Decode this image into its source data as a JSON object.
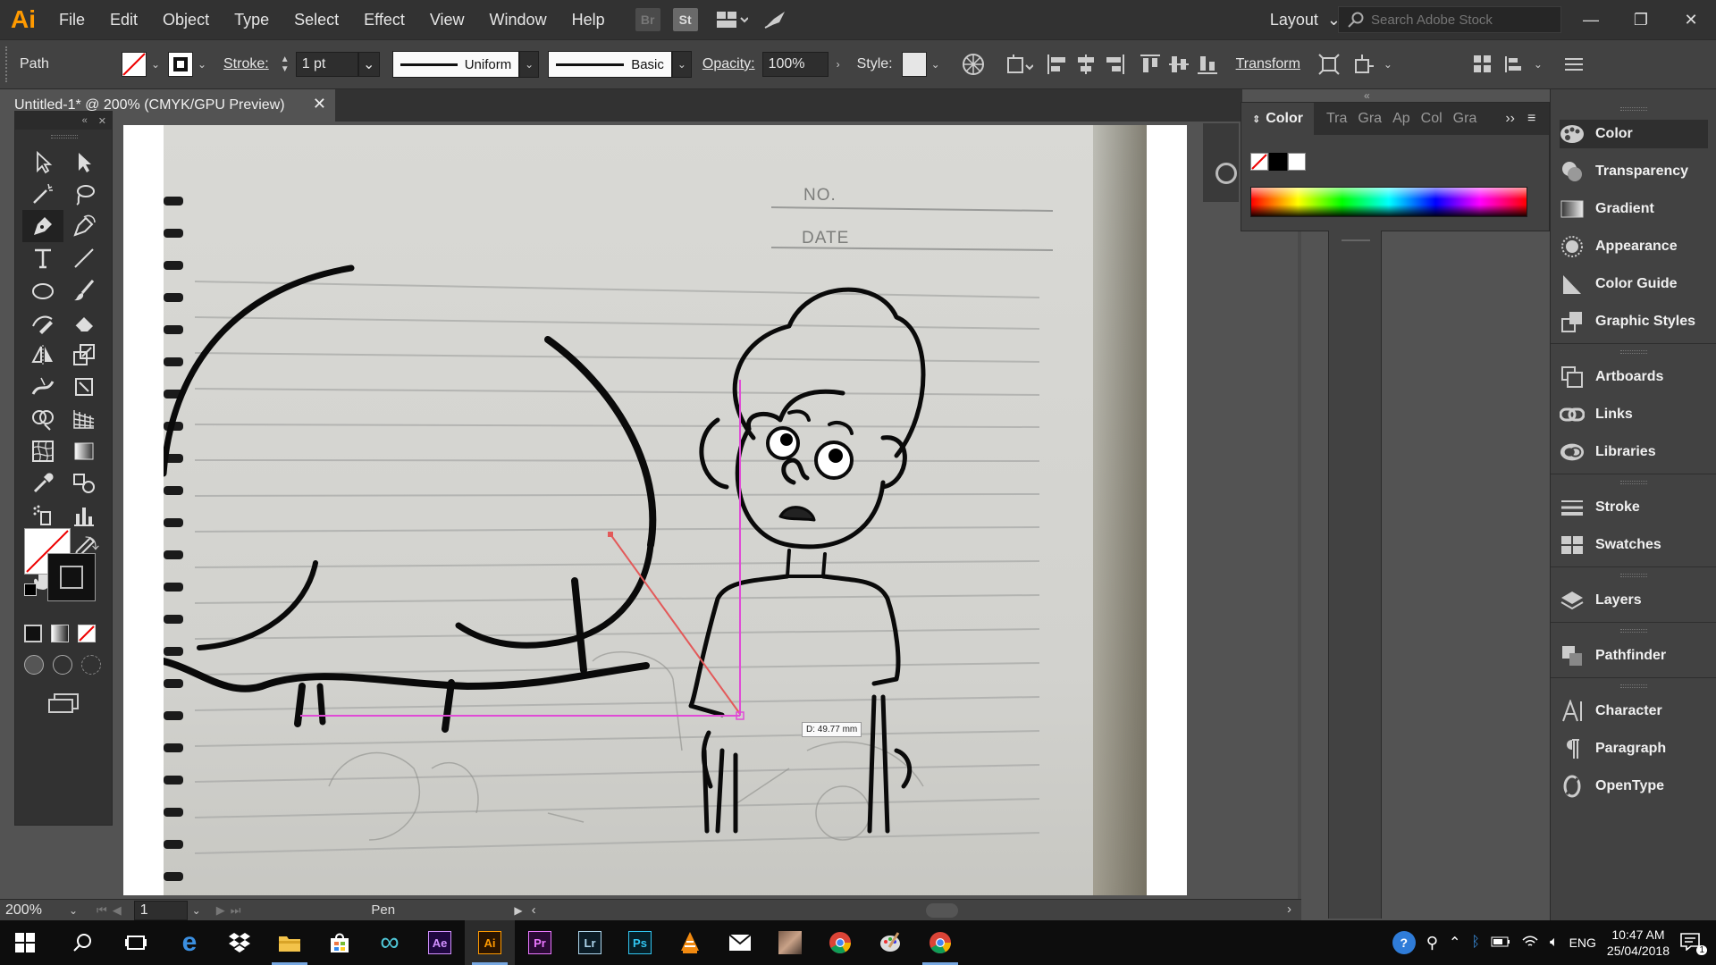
{
  "app": {
    "logo": "Ai",
    "menu": [
      "File",
      "Edit",
      "Object",
      "Type",
      "Select",
      "Effect",
      "View",
      "Window",
      "Help"
    ],
    "bridge_label": "Br",
    "stock_label": "St",
    "workspace": "Layout",
    "search_placeholder": "Search Adobe Stock"
  },
  "control_bar": {
    "selection_type": "Path",
    "stroke_label": "Stroke:",
    "stroke_weight": "1 pt",
    "profile": "Uniform",
    "brush": "Basic",
    "opacity_label": "Opacity:",
    "opacity_value": "100%",
    "style_label": "Style:",
    "transform_label": "Transform"
  },
  "document": {
    "tab_title": "Untitled-1* @ 200% (CMYK/GPU Preview)",
    "close": "✕"
  },
  "canvas": {
    "notebook_no": "NO.",
    "notebook_date": "DATE",
    "measure_readout": "D: 49.77 mm"
  },
  "color_panel": {
    "tabs": [
      "Color",
      "Tra",
      "Gra",
      "Ap",
      "Col",
      "Gra"
    ]
  },
  "panels": [
    {
      "label": "Color",
      "icon": "palette-icon"
    },
    {
      "label": "Transparency",
      "icon": "transparency-icon"
    },
    {
      "label": "Gradient",
      "icon": "gradient-icon"
    },
    {
      "label": "Appearance",
      "icon": "appearance-icon"
    },
    {
      "label": "Color Guide",
      "icon": "color-guide-icon"
    },
    {
      "label": "Graphic Styles",
      "icon": "graphic-styles-icon"
    },
    {
      "label": "Artboards",
      "icon": "artboards-icon"
    },
    {
      "label": "Links",
      "icon": "links-icon"
    },
    {
      "label": "Libraries",
      "icon": "libraries-icon"
    },
    {
      "label": "Stroke",
      "icon": "stroke-icon"
    },
    {
      "label": "Swatches",
      "icon": "swatches-icon"
    },
    {
      "label": "Layers",
      "icon": "layers-icon"
    },
    {
      "label": "Pathfinder",
      "icon": "pathfinder-icon"
    },
    {
      "label": "Character",
      "icon": "character-icon"
    },
    {
      "label": "Paragraph",
      "icon": "paragraph-icon"
    },
    {
      "label": "OpenType",
      "icon": "opentype-icon"
    }
  ],
  "status_bar": {
    "zoom": "200%",
    "artboard_number": "1",
    "current_tool": "Pen"
  },
  "taskbar": {
    "apps": [
      "Ae",
      "Ai",
      "Pr",
      "Lr",
      "Ps"
    ],
    "language": "ENG",
    "time": "10:47 AM",
    "date": "25/04/2018",
    "notification_count": "1"
  },
  "colors": {
    "ai_orange": "#ff9a00",
    "ae_purple": "#d291ff",
    "pr_purple": "#ea77ff",
    "lr_blue": "#add5ec",
    "ps_blue": "#31c5f0",
    "guide_magenta": "#e04bd6",
    "path_red": "#e35a5a"
  }
}
